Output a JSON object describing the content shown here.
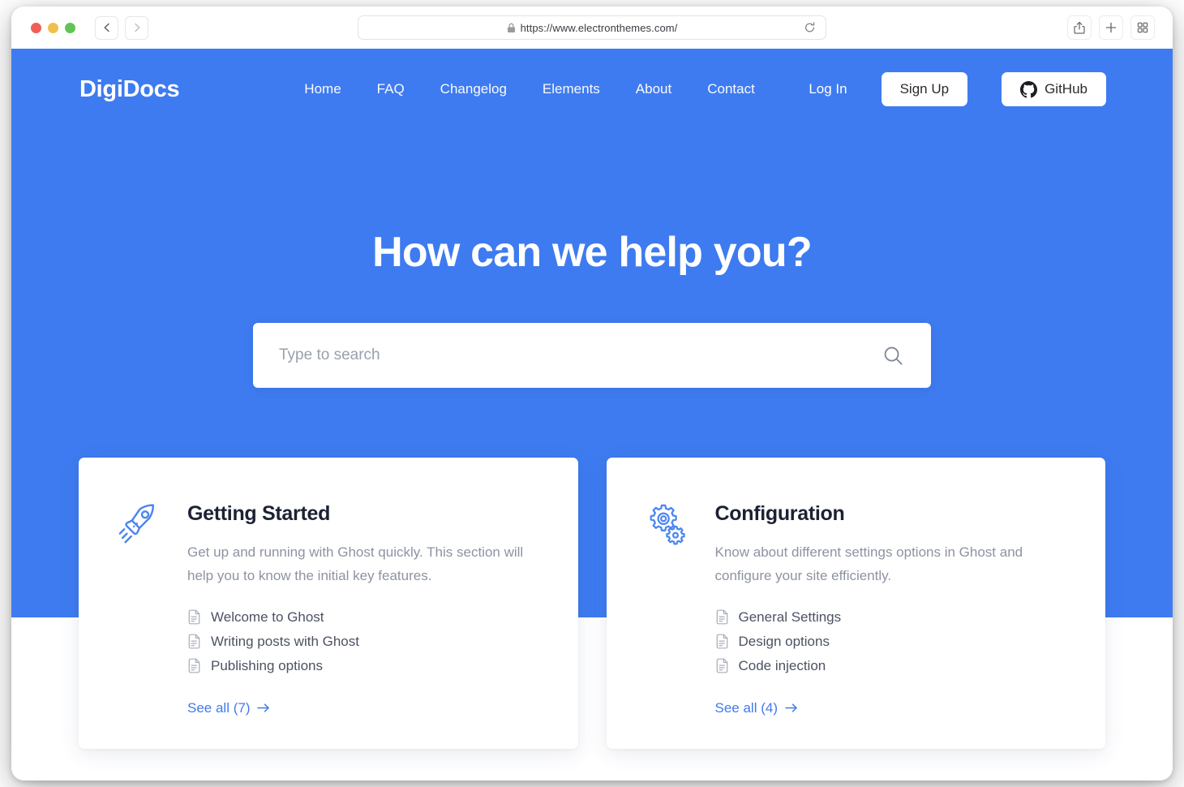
{
  "browser": {
    "url": "https://www.electronthemes.com/",
    "lock_icon": "lock-icon",
    "back_icon": "chevron-left-icon",
    "forward_icon": "chevron-right-icon",
    "reload_icon": "reload-icon",
    "share_icon": "share-icon",
    "new_tab_icon": "plus-icon",
    "tab_overview_icon": "grid-icon",
    "traffic_lights": [
      "close-red",
      "minimize-yellow",
      "maximize-green"
    ]
  },
  "site": {
    "brand": "DigiDocs",
    "nav": [
      {
        "label": "Home"
      },
      {
        "label": "FAQ"
      },
      {
        "label": "Changelog"
      },
      {
        "label": "Elements"
      },
      {
        "label": "About"
      },
      {
        "label": "Contact"
      },
      {
        "label": "Log In"
      }
    ],
    "signup_label": "Sign Up",
    "github_label": "GitHub",
    "github_icon": "github-icon"
  },
  "hero": {
    "title": "How can we help you?",
    "search": {
      "placeholder": "Type to search",
      "value": "",
      "icon": "search-icon"
    },
    "background_color": "#3e7bf0"
  },
  "cards": [
    {
      "icon": "rocket-icon",
      "title": "Getting Started",
      "description": "Get up and running with Ghost quickly. This section will help you to know the initial key features.",
      "items": [
        {
          "icon": "document-icon",
          "label": "Welcome to Ghost"
        },
        {
          "icon": "document-icon",
          "label": "Writing posts with Ghost"
        },
        {
          "icon": "document-icon",
          "label": "Publishing options"
        }
      ],
      "see_all": "See all (7)",
      "arrow_icon": "arrow-right-icon"
    },
    {
      "icon": "gears-icon",
      "title": "Configuration",
      "description": "Know about different settings options in Ghost and configure your site efficiently.",
      "items": [
        {
          "icon": "document-icon",
          "label": "General Settings"
        },
        {
          "icon": "document-icon",
          "label": "Design options"
        },
        {
          "icon": "document-icon",
          "label": "Code injection"
        }
      ],
      "see_all": "See all (4)",
      "arrow_icon": "arrow-right-icon"
    }
  ],
  "colors": {
    "brand_blue": "#3e7bf0",
    "link_blue": "#4279ee",
    "icon_blue": "#4a85f0",
    "text_dark": "#1c2233",
    "text_muted": "#8d93a1"
  }
}
